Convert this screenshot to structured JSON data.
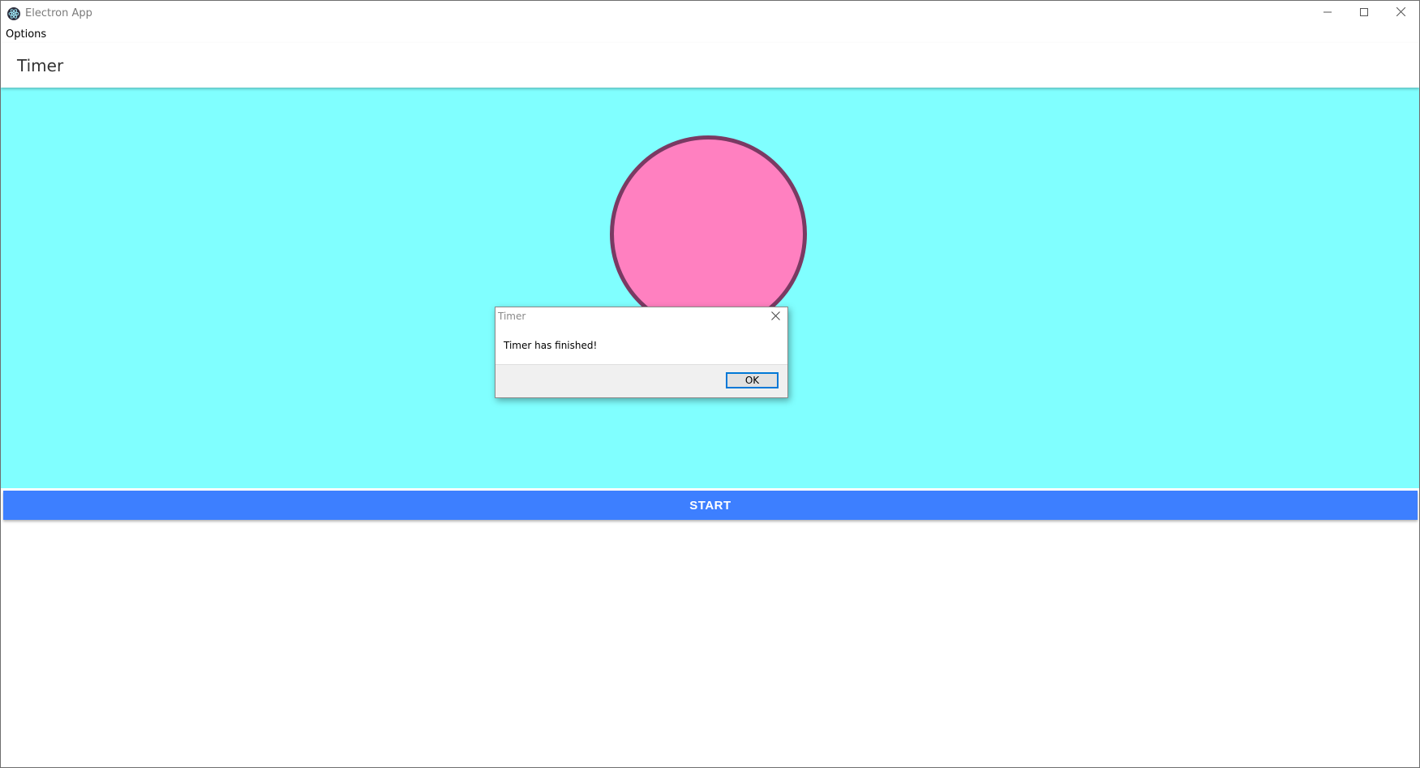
{
  "window": {
    "title": "Electron App",
    "controls": {
      "minimize_icon": "minimize-icon",
      "maximize_icon": "maximize-icon",
      "close_icon": "close-icon"
    }
  },
  "menu": {
    "items": [
      {
        "label": "Options"
      }
    ]
  },
  "header": {
    "title": "Timer"
  },
  "stage": {
    "background_color": "#80ffff",
    "circle_fill": "#ff80c0",
    "circle_stroke": "#7a3a63"
  },
  "start_button": {
    "label": "START",
    "color": "#3d7fff"
  },
  "dialog": {
    "title": "Timer",
    "message": "Timer has finished!",
    "ok_label": "OK"
  }
}
